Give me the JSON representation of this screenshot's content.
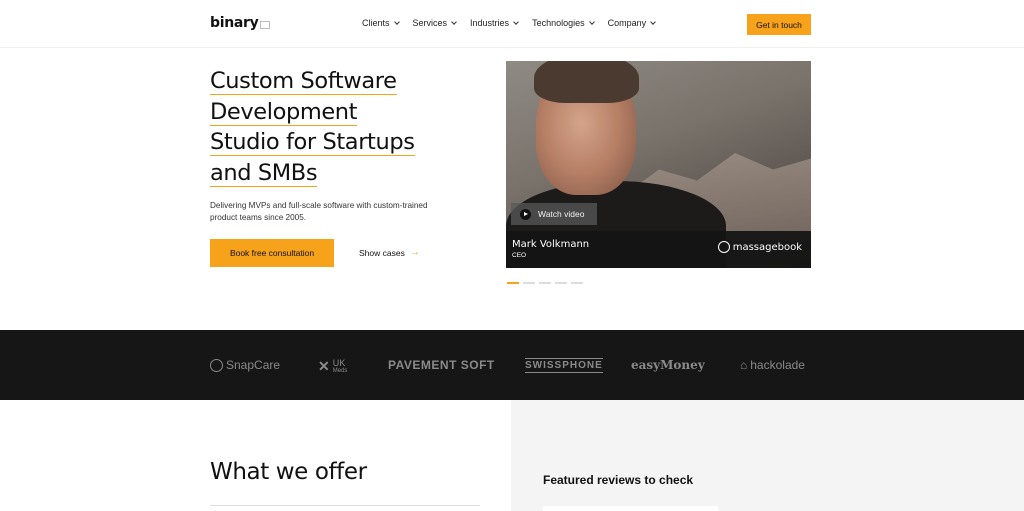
{
  "header": {
    "logo": "binary",
    "nav": [
      {
        "label": "Clients"
      },
      {
        "label": "Services"
      },
      {
        "label": "Industries"
      },
      {
        "label": "Technologies"
      },
      {
        "label": "Company"
      }
    ],
    "cta": "Get in touch"
  },
  "hero": {
    "title_lines": [
      "Custom Software",
      "Development",
      "Studio for Startups",
      "and SMBs"
    ],
    "subtitle": "Delivering MVPs and full-scale software with custom-trained product teams since 2005.",
    "primary_button": "Book free consultation",
    "secondary_link": "Show cases",
    "video": {
      "watch_label": "Watch video",
      "person_name": "Mark Volkmann",
      "person_role": "CEO",
      "company": "massagebook"
    }
  },
  "client_logos": [
    "SnapCare",
    "UK",
    "Meds",
    "PAVEMENT SOFT",
    "SWISSPHONE",
    "easyMoney",
    "hackolade"
  ],
  "offer": {
    "title": "What we offer"
  },
  "reviews": {
    "title": "Featured reviews to check"
  },
  "colors": {
    "accent": "#f7a21b",
    "dark_strip": "#161616",
    "panel": "#f4f4f4"
  }
}
